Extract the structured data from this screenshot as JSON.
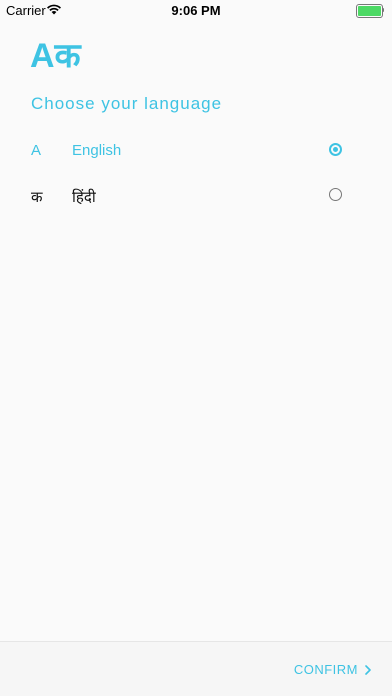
{
  "status_bar": {
    "carrier": "Carrier",
    "time": "9:06 PM",
    "battery_level": 1.0,
    "wifi_icon": "wifi-icon"
  },
  "header": {
    "logo_text": "Aक",
    "title": "Choose your language"
  },
  "languages": [
    {
      "glyph": "A",
      "name": "English",
      "selected": true
    },
    {
      "glyph": "क",
      "name": "हिंदी",
      "selected": false
    }
  ],
  "footer": {
    "confirm_label": "CONFIRM"
  },
  "colors": {
    "accent": "#3ec3e3",
    "background": "#fafafa"
  }
}
